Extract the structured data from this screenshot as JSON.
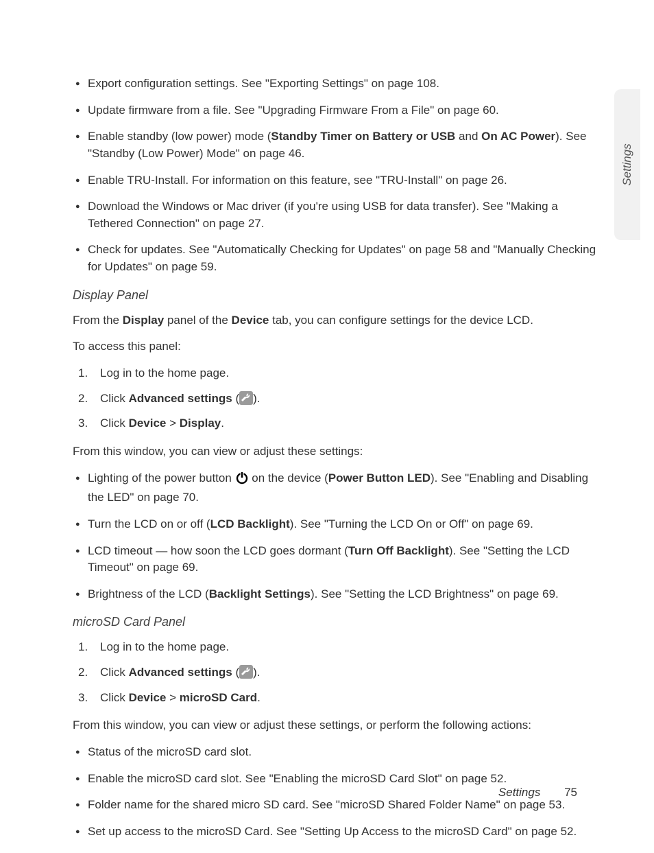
{
  "side_tab": "Settings",
  "top_bullets": [
    {
      "pre": "Export configuration settings. See \"Exporting Settings\" on page 108."
    },
    {
      "pre": "Update firmware from a file. See \"Upgrading Firmware From a File\" on page 60."
    },
    {
      "pre": "Enable standby (low power) mode (",
      "b1": "Standby Timer on Battery or USB",
      "mid": " and ",
      "b2": "On AC Power",
      "post": "). See \"Standby (Low Power) Mode\" on page 46."
    },
    {
      "pre": "Enable TRU-Install. For information on this feature, see \"TRU-Install\" on page 26."
    },
    {
      "pre": "Download the Windows or Mac driver (if you're using USB for data transfer). See \"Making a Tethered Connection\" on page 27."
    },
    {
      "pre": "Check for updates. See \"Automatically Checking for Updates\" on page 58 and \"Manually Checking for Updates\" on page 59."
    }
  ],
  "display": {
    "heading": "Display Panel",
    "intro": {
      "p1": "From the ",
      "b1": "Display",
      "p2": " panel of the ",
      "b2": "Device",
      "p3": " tab, you can configure settings for the device LCD."
    },
    "access": "To access this panel:",
    "steps": {
      "s1": "Log in to the home page.",
      "s2": {
        "pre": "Click ",
        "b": "Advanced settings",
        "post1": " (",
        "post2": ")."
      },
      "s3": {
        "pre": "Click ",
        "b1": "Device",
        "mid": " > ",
        "b2": "Display",
        "post": "."
      }
    },
    "after": "From this window, you can view or adjust these settings:",
    "bullets": [
      {
        "pre": "Lighting of the power button ",
        "post1": " on the device (",
        "b": "Power Button LED",
        "post2": "). See \"Enabling and Disabling the LED\" on page 70."
      },
      {
        "pre": "Turn the LCD on or off (",
        "b": "LCD Backlight",
        "post": "). See \"Turning the LCD On or Off\" on page 69."
      },
      {
        "pre": "LCD timeout — how soon the LCD goes dormant (",
        "b": "Turn Off Backlight",
        "post": "). See \"Setting the LCD Timeout\" on page 69."
      },
      {
        "pre": "Brightness of the LCD (",
        "b": "Backlight Settings",
        "post": "). See \"Setting the LCD Brightness\" on page 69."
      }
    ]
  },
  "microsd": {
    "heading": "microSD Card Panel",
    "steps": {
      "s1": "Log in to the home page.",
      "s2": {
        "pre": "Click ",
        "b": "Advanced settings",
        "post1": " (",
        "post2": ")."
      },
      "s3": {
        "pre": "Click ",
        "b1": "Device",
        "mid": " > ",
        "b2": "microSD Card",
        "post": "."
      }
    },
    "after": "From this window, you can view or adjust these settings, or perform the following actions:",
    "bullets": [
      "Status of the microSD card slot.",
      "Enable the microSD card slot. See \"Enabling the microSD Card Slot\" on page 52.",
      "Folder name for the shared micro SD card. See \"microSD Shared Folder Name\" on page 53.",
      "Set up access to the microSD Card. See \"Setting Up Access to the microSD Card\" on page 52."
    ]
  },
  "footer": {
    "section": "Settings",
    "page": "75"
  }
}
